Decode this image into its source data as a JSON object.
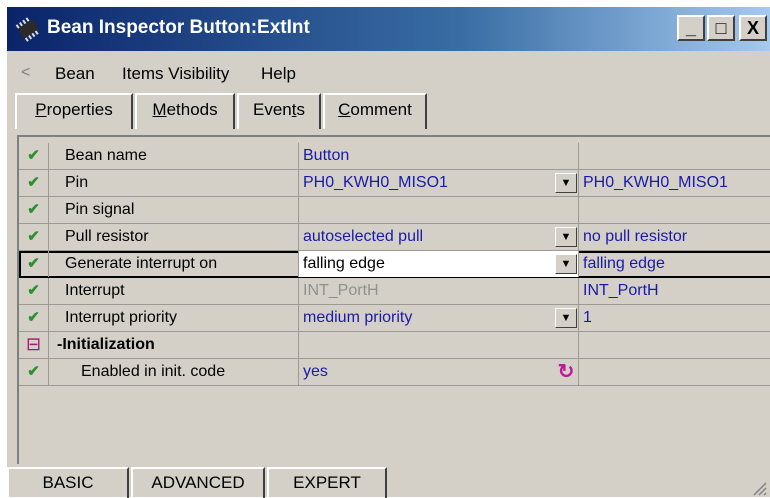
{
  "window": {
    "title": "Bean Inspector Button:ExtInt",
    "minimize_label": "_",
    "maximize_label": "□",
    "close_label": "X"
  },
  "menu": {
    "items": [
      {
        "label": "Bean"
      },
      {
        "label": "Items Visibility"
      },
      {
        "label": "Help"
      }
    ]
  },
  "tabs": [
    {
      "label": "Properties",
      "underline": "P",
      "rest": "roperties"
    },
    {
      "label": "Methods",
      "underline": "M",
      "rest": "ethods"
    },
    {
      "label": "Events",
      "pre": "Even",
      "underline": "t",
      "rest": "s"
    },
    {
      "label": "Comment",
      "underline": "C",
      "rest": "omment"
    }
  ],
  "grid": {
    "rows": [
      {
        "name": "Bean name",
        "value": "Button",
        "value2": ""
      },
      {
        "name": "Pin",
        "value": "PH0_KWH0_MISO1",
        "value2": "PH0_KWH0_MISO1"
      },
      {
        "name": "Pin signal",
        "value": "",
        "value2": ""
      },
      {
        "name": "Pull resistor",
        "value": "autoselected pull",
        "value2": "no pull resistor"
      },
      {
        "name": "Generate interrupt on",
        "value": "falling edge",
        "value2": "falling edge"
      },
      {
        "name": "Interrupt",
        "value": "INT_PortH",
        "value2": "INT_PortH"
      },
      {
        "name": "Interrupt priority",
        "value": "medium priority",
        "value2": "1"
      },
      {
        "name": "-Initialization",
        "value": "",
        "value2": ""
      },
      {
        "name": "Enabled in init. code",
        "value": "yes",
        "value2": ""
      }
    ],
    "check_symbol": "✔",
    "collapse_symbol": "⊟",
    "dropdown_symbol": "▼",
    "refresh_symbol": "↻"
  },
  "bottom_tabs": [
    {
      "label": "BASIC"
    },
    {
      "label": "ADVANCED"
    },
    {
      "label": "EXPERT"
    }
  ]
}
